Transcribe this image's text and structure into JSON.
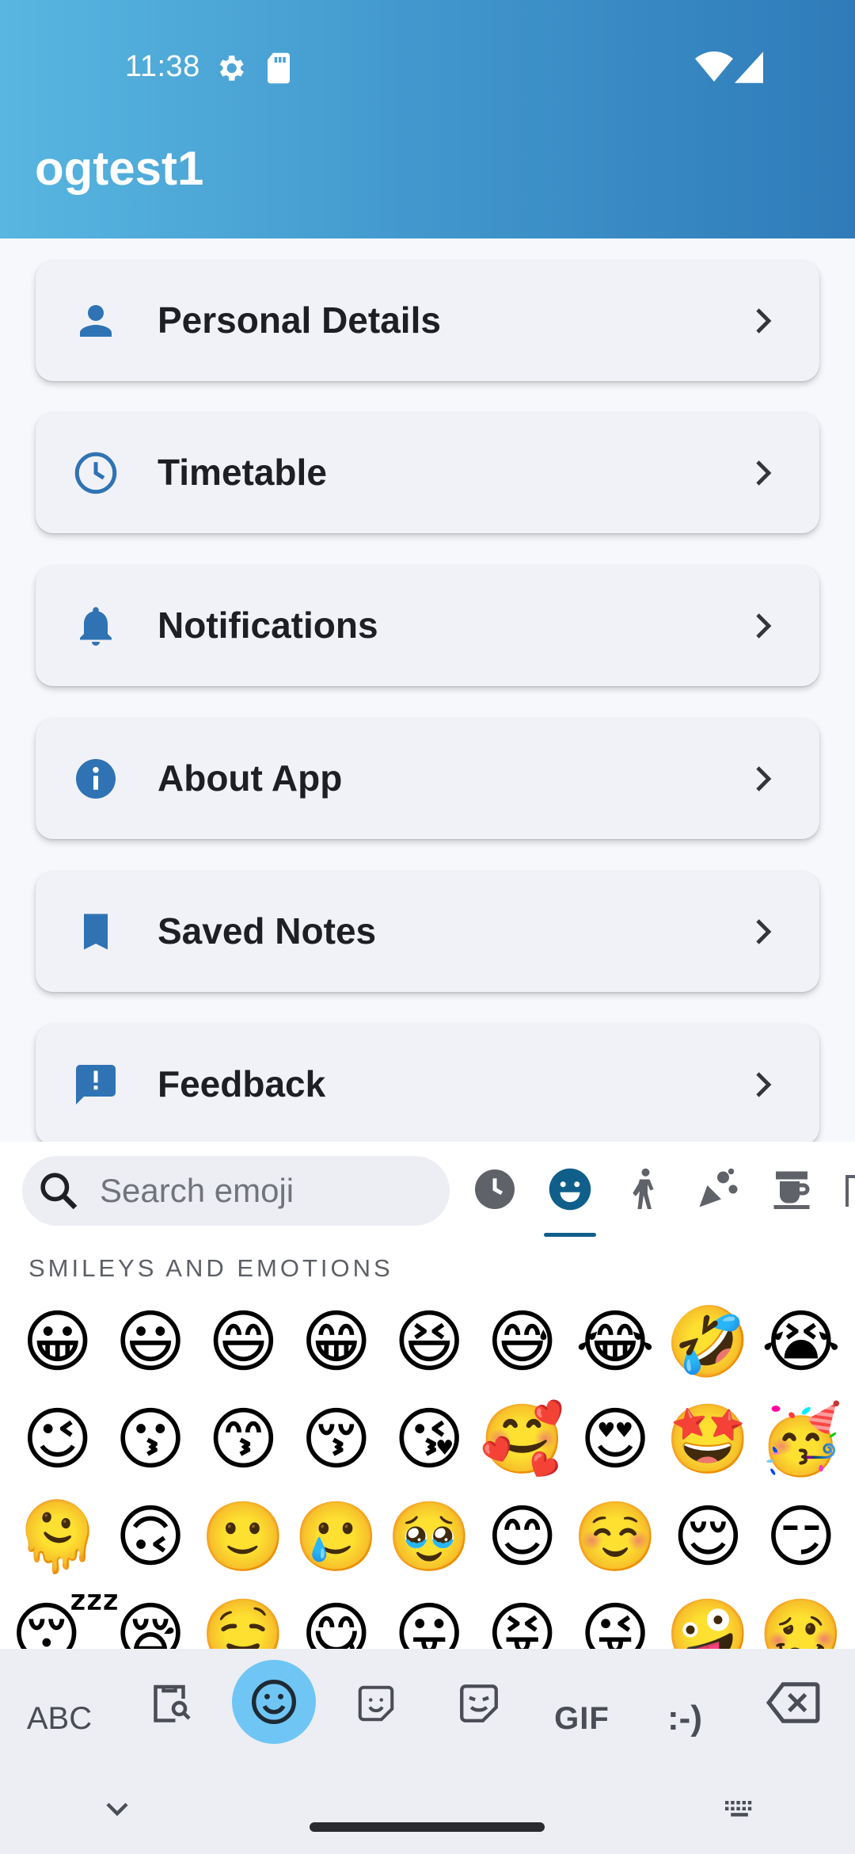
{
  "status_bar": {
    "time": "11:38",
    "icons": [
      "settings-gear-icon",
      "sd-card-icon",
      "wifi-icon",
      "cellular-signal-icon"
    ]
  },
  "app_bar": {
    "title": "ogtest1"
  },
  "colors": {
    "accent": "#2f7bb9",
    "card_bg": "#f1f2f7",
    "selected_tab": "#6fc6f4"
  },
  "menu": [
    {
      "label": "Personal Details",
      "icon": "person-icon"
    },
    {
      "label": "Timetable",
      "icon": "clock-icon"
    },
    {
      "label": "Notifications",
      "icon": "bell-icon"
    },
    {
      "label": "About App",
      "icon": "info-icon"
    },
    {
      "label": "Saved Notes",
      "icon": "bookmark-icon"
    },
    {
      "label": "Feedback",
      "icon": "feedback-icon"
    }
  ],
  "emoji_panel": {
    "search_placeholder": "Search emoji",
    "categories": [
      "recent-icon",
      "smiley-icon",
      "people-activity-icon",
      "celebration-icon",
      "food-drink-icon"
    ],
    "selected_category": "smiley-icon",
    "section_title": "SMILEYS AND EMOTIONS",
    "rows": [
      [
        "😀",
        "😃",
        "😄",
        "😁",
        "😆",
        "😅",
        "😂",
        "🤣",
        "😭"
      ],
      [
        "😉",
        "😗",
        "😙",
        "😚",
        "😘",
        "🥰",
        "😍",
        "🤩",
        "🥳"
      ],
      [
        "🫠",
        "🙃",
        "🙂",
        "🥲",
        "🥹",
        "😊",
        "☺️",
        "😌",
        "😏"
      ],
      [
        "😴",
        "😪",
        "🤤",
        "😋",
        "😛",
        "😝",
        "😜",
        "🤪",
        "🥴"
      ]
    ]
  },
  "keyboard_bar": {
    "abc": "ABC",
    "gif": "GIF",
    "emoticon": ":-)",
    "icons": [
      "clipboard-search-icon",
      "emoji-icon",
      "sticker-icon",
      "bitmoji-icon",
      "backspace-icon"
    ]
  }
}
